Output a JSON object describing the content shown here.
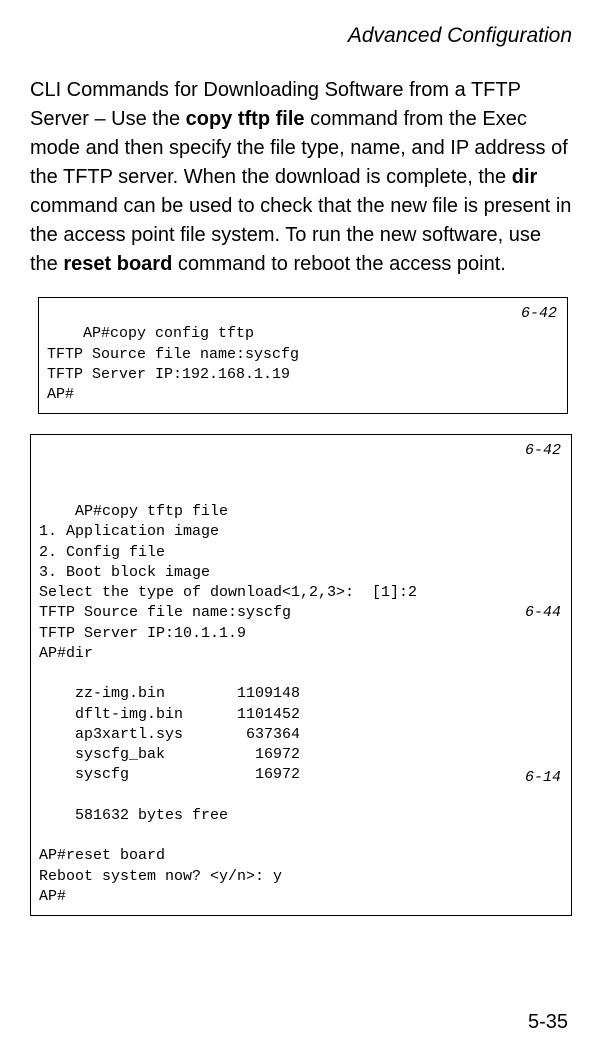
{
  "header": {
    "running_title": "Advanced Configuration"
  },
  "paragraph": {
    "p1": "CLI Commands for Downloading Software from a TFTP Server – Use the ",
    "b1": "copy tftp file",
    "p2": " command from the Exec mode and then specify the file type, name, and IP address of the TFTP server. When the download is complete, the ",
    "b2": "dir",
    "p3": " command can be used to check that the new file is present in the access point file system. To run the new software, use the ",
    "b3": "reset board",
    "p4": " command to reboot the access point."
  },
  "code1": {
    "ref": "6-42",
    "line1": "AP#copy config tftp",
    "line2": "TFTP Source file name:syscfg",
    "line3": "TFTP Server IP:192.168.1.19",
    "line4": "AP#"
  },
  "code2": {
    "ref_a": "6-42",
    "ref_b": "6-44",
    "ref_c": "6-14",
    "line1": "AP#copy tftp file",
    "line2": "1. Application image",
    "line3": "2. Config file",
    "line4": "3. Boot block image",
    "line5": "Select the type of download<1,2,3>:  [1]:2",
    "line6": "TFTP Source file name:syscfg",
    "line7": "TFTP Server IP:10.1.1.9",
    "line8": "AP#dir",
    "line9": "",
    "line10": "    zz-img.bin        1109148",
    "line11": "    dflt-img.bin      1101452",
    "line12": "    ap3xartl.sys       637364",
    "line13": "    syscfg_bak          16972",
    "line14": "    syscfg              16972",
    "line15": "",
    "line16": "    581632 bytes free",
    "line17": "",
    "line18": "AP#reset board",
    "line19": "Reboot system now? <y/n>: y",
    "line20": "AP#"
  },
  "footer": {
    "page_number": "5-35"
  }
}
